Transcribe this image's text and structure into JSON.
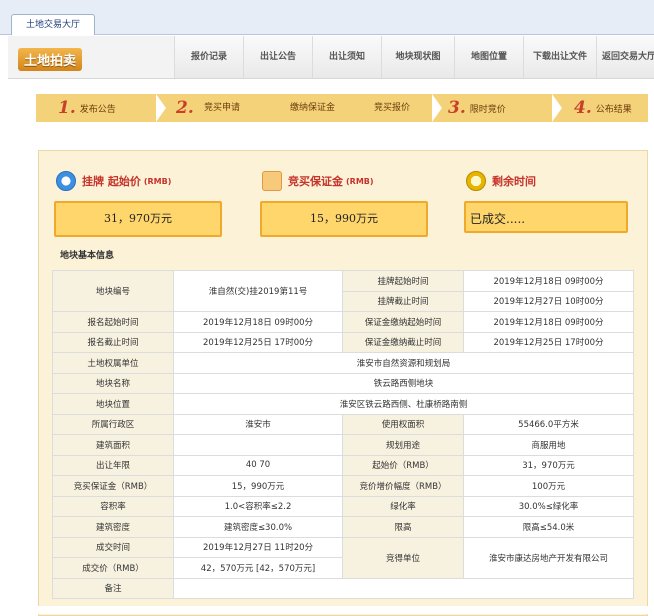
{
  "tab": {
    "title": "土地交易大厅"
  },
  "header": {
    "logo": "土地拍卖",
    "nav": [
      {
        "label": "报价记录",
        "w": 68
      },
      {
        "label": "出让公告",
        "w": 68
      },
      {
        "label": "出让须知",
        "w": 68
      },
      {
        "label": "地块现状图",
        "w": 72
      },
      {
        "label": "地图位置",
        "w": 68
      },
      {
        "label": "下载出让文件",
        "w": 72
      },
      {
        "label": "返回交易大厅",
        "w": 64
      }
    ]
  },
  "steps": {
    "s1": {
      "num": "1.",
      "label": "发布公告"
    },
    "s2": {
      "num": "2.",
      "sub": [
        "竞买申请",
        "缴纳保证金",
        "竞买报价"
      ]
    },
    "s3": {
      "num": "3.",
      "label": "限时竞价"
    },
    "s4": {
      "num": "4.",
      "label": "公布结果"
    }
  },
  "prices": {
    "start": {
      "title": "挂牌 起始价",
      "unit": "(RMB)",
      "value": "31，970万元"
    },
    "deposit": {
      "title": "竞买保证金",
      "unit": "(RMB)",
      "value": "15，990万元"
    },
    "remain": {
      "title": "剩余时间",
      "value": "已成交....."
    }
  },
  "section_title": "地块基本信息",
  "table": {
    "r1": {
      "l1": "地块编号",
      "v1": "淮自然(交)挂2019第11号",
      "l2a": "挂牌起始时间",
      "v2a": "2019年12月18日 09时00分",
      "l2b": "挂牌截止时间",
      "v2b": "2019年12月27日 10时00分"
    },
    "r3": {
      "l1": "报名起始时间",
      "v1": "2019年12月18日 09时00分",
      "l2": "保证金缴纳起始时间",
      "v2": "2019年12月18日 09时00分"
    },
    "r4": {
      "l1": "报名截止时间",
      "v1": "2019年12月25日 17时00分",
      "l2": "保证金缴纳截止时间",
      "v2": "2019年12月25日 17时00分"
    },
    "r5": {
      "l1": "土地权属单位",
      "v1": "淮安市自然资源和规划局"
    },
    "r6": {
      "l1": "地块名称",
      "v1": "铁云路西侧地块"
    },
    "r7": {
      "l1": "地块位置",
      "v1": "淮安区铁云路西侧、杜康桥路南侧"
    },
    "r8": {
      "l1": "所属行政区",
      "v1": "淮安市",
      "l2": "使用权面积",
      "v2": "55466.0平方米"
    },
    "r9": {
      "l1": "建筑面积",
      "v1": "",
      "l2": "规划用途",
      "v2": "商服用地"
    },
    "r10": {
      "l1": "出让年限",
      "v1": "40 70",
      "l2": "起始价（RMB）",
      "v2": "31，970万元"
    },
    "r11": {
      "l1": "竞买保证金（RMB）",
      "v1": "15，990万元",
      "l2": "竞价增价幅度（RMB）",
      "v2": "100万元"
    },
    "r12": {
      "l1": "容积率",
      "v1": "1.0<容积率≤2.2",
      "l2": "绿化率",
      "v2": "30.0%≤绿化率"
    },
    "r13": {
      "l1": "建筑密度",
      "v1": "建筑密度≤30.0%",
      "l2": "限高",
      "v2": "限高≤54.0米"
    },
    "r14": {
      "l1": "成交时间",
      "v1": "2019年12月27日 11时20分",
      "l2": "竞得单位",
      "v2": "淮安市康达房地产开发有限公司"
    },
    "r15": {
      "l1": "成交价（RMB）",
      "v1": "42，570万元 [42，570万元]"
    },
    "r16": {
      "l1": "备注",
      "v1": ""
    }
  },
  "colors": {
    "accent": "#c6332a",
    "gold": "#ffd66b",
    "steps": "#f4d27a",
    "panel": "#fbf2d8"
  }
}
